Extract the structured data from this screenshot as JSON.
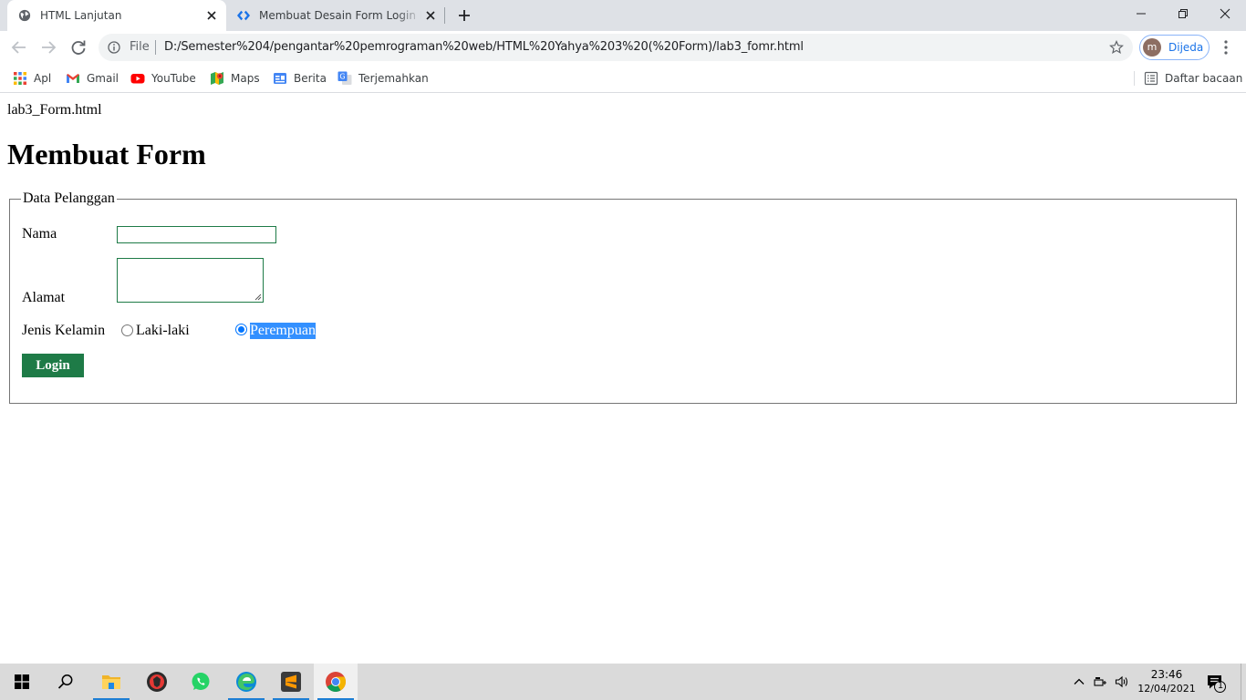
{
  "browser": {
    "tabs": [
      {
        "title": "HTML Lanjutan",
        "active": true
      },
      {
        "title": "Membuat Desain Form Login Der",
        "active": false
      }
    ],
    "address": {
      "scheme_label": "File",
      "url": "D:/Semester%204/pengantar%20pemrograman%20web/HTML%20Yahya%203%20(%20Form)/lab3_fomr.html"
    },
    "profile": {
      "initial": "m",
      "name": "Dijeda"
    },
    "bookmarks": [
      {
        "label": "Apl",
        "icon": "apps-grid-icon"
      },
      {
        "label": "Gmail",
        "icon": "gmail-icon"
      },
      {
        "label": "YouTube",
        "icon": "youtube-icon"
      },
      {
        "label": "Maps",
        "icon": "maps-icon"
      },
      {
        "label": "Berita",
        "icon": "news-icon"
      },
      {
        "label": "Terjemahkan",
        "icon": "translate-icon"
      }
    ],
    "reading_list": "Daftar bacaan"
  },
  "page": {
    "filename": "lab3_Form.html",
    "title": "Membuat Form",
    "fieldset_legend": "Data Pelanggan",
    "form": {
      "name_label": "Nama",
      "name_value": "",
      "address_label": "Alamat",
      "address_value": "",
      "gender_label": "Jenis Kelamin",
      "gender_options": [
        {
          "label": "Laki-laki",
          "checked": false
        },
        {
          "label": "Perempuan",
          "checked": true
        }
      ],
      "submit_label": "Login"
    }
  },
  "taskbar": {
    "time": "23:46",
    "date": "12/04/2021",
    "notification_count": "1"
  },
  "colors": {
    "accent_green": "#1e7b47",
    "selection_blue": "#3390ff",
    "radio_blue": "#0075ff",
    "tabstrip": "#dee1e6"
  }
}
